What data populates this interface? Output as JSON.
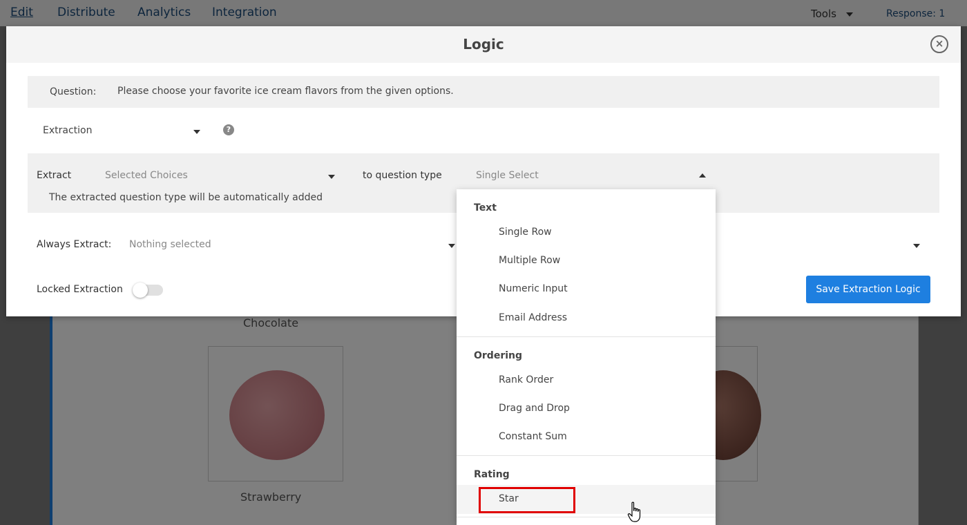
{
  "topbar": {
    "nav": [
      "Edit",
      "Distribute",
      "Analytics",
      "Integration"
    ],
    "tools_label": "Tools",
    "response_label": "Response: 1"
  },
  "survey": {
    "choices": [
      "Chocolate",
      "Strawberry"
    ]
  },
  "modal": {
    "title": "Logic",
    "question_prefix": "Question:",
    "question_text": "Please choose your favorite ice cream flavors from the given options.",
    "extraction_type": "Extraction",
    "extract_label": "Extract",
    "extract_value": "Selected Choices",
    "to_type_label": "to question type",
    "to_type_value": "Single Select",
    "auto_note": "The extracted question type will be automatically added",
    "always_extract_label": "Always Extract:",
    "always_extract_value": "Nothing selected",
    "locked_label": "Locked Extraction",
    "locked_on": false,
    "save_label": "Save Extraction Logic"
  },
  "dropdown": {
    "groups": [
      {
        "label": "Text",
        "options": [
          "Single Row",
          "Multiple Row",
          "Numeric Input",
          "Email Address"
        ]
      },
      {
        "label": "Ordering",
        "options": [
          "Rank Order",
          "Drag and Drop",
          "Constant Sum"
        ]
      },
      {
        "label": "Rating",
        "options": [
          "Star"
        ]
      }
    ],
    "hovered_option": "Star"
  },
  "colors": {
    "accent": "#1e7fe0",
    "highlight": "#e00000",
    "nav_text": "#1a4a7a"
  }
}
